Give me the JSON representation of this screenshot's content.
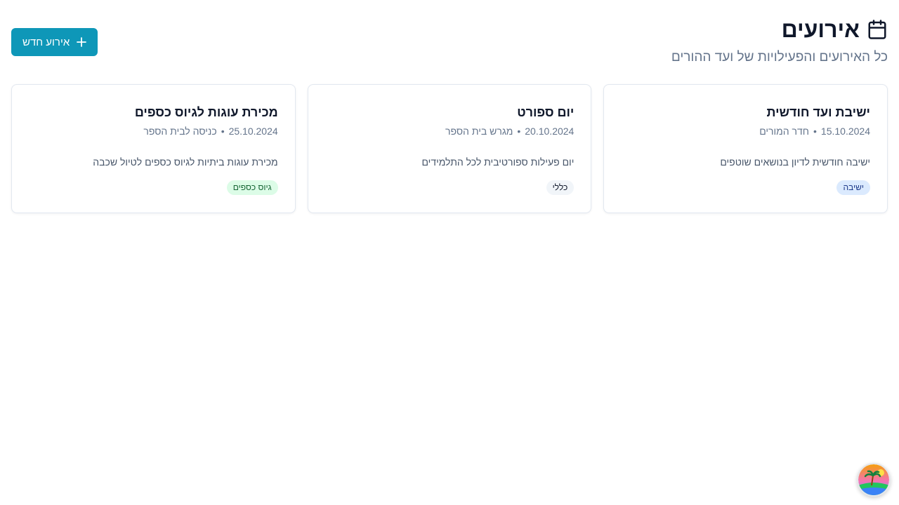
{
  "header": {
    "title": "אירועים",
    "subtitle": "כל האירועים והפעילויות של ועד ההורים",
    "icon": "calendar-icon",
    "new_button_label": "אירוע חדש",
    "new_button_icon": "plus-icon"
  },
  "events": [
    {
      "title": "ישיבת ועד חודשית",
      "date": "15.10.2024",
      "separator": "•",
      "location": "חדר המורים",
      "description": "ישיבה חודשית לדיון בנושאים שוטפים",
      "tag": "ישיבה",
      "tag_color": "#dbeafe"
    },
    {
      "title": "יום ספורט",
      "date": "20.10.2024",
      "separator": "•",
      "location": "מגרש בית הספר",
      "description": "יום פעילות ספורטיבית לכל התלמידים",
      "tag": "כללי",
      "tag_color": "#f1f5f9"
    },
    {
      "title": "מכירת עוגות לגיוס כספים",
      "date": "25.10.2024",
      "separator": "•",
      "location": "כניסה לבית הספר",
      "description": "מכירת עוגות ביתיות לגיוס כספים לטיול שכבה",
      "tag": "גיוס כספים",
      "tag_color": "#dcfce7"
    }
  ],
  "colors": {
    "primary": "#0e97b8",
    "text": "#0f172a",
    "muted": "#64748b"
  },
  "floating_button": {
    "icon": "beach-avatar-icon"
  }
}
